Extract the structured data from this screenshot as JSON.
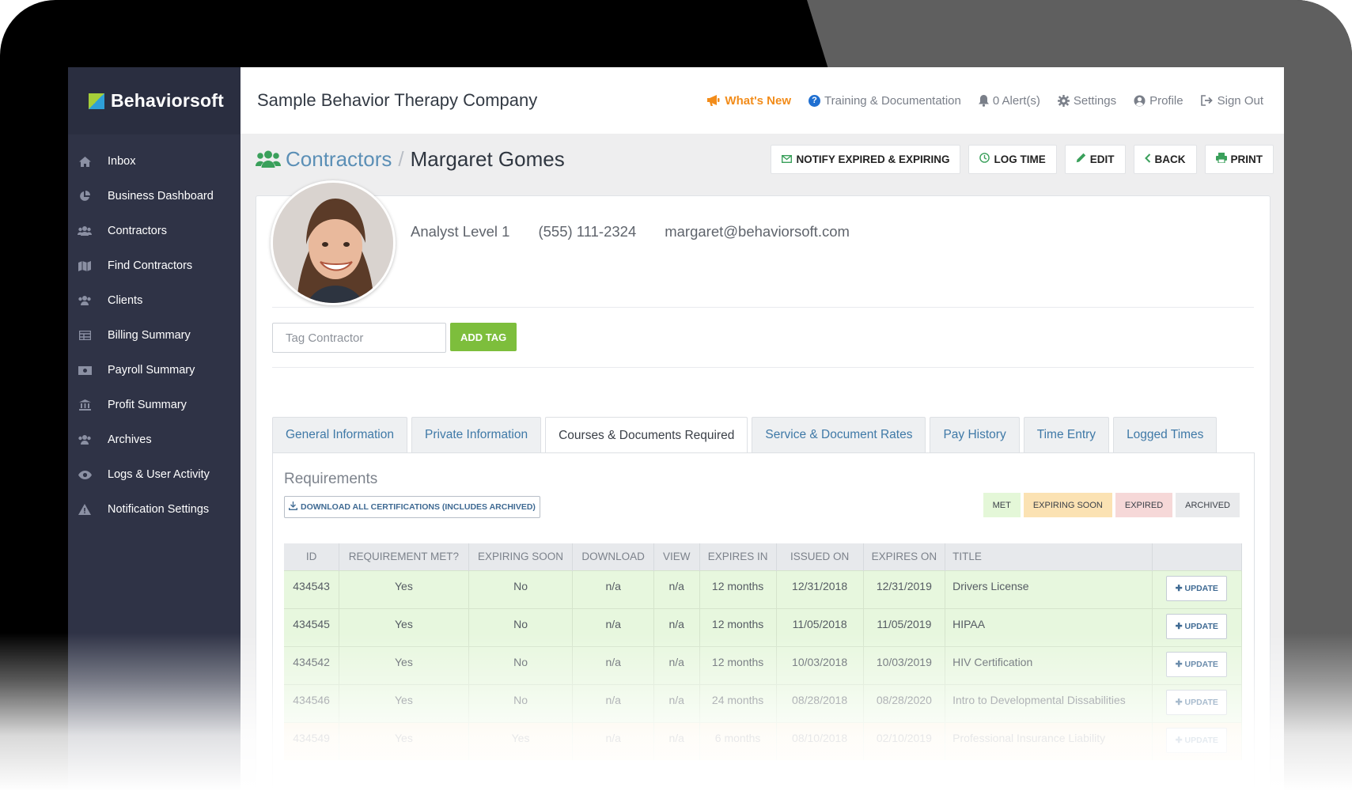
{
  "app": {
    "brand": "Behaviorsoft",
    "company": "Sample Behavior Therapy Company"
  },
  "topnav": [
    {
      "label": "What's New",
      "icon": "megaphone-icon"
    },
    {
      "label": "Training & Documentation",
      "icon": "question-circle-icon"
    },
    {
      "label": "0 Alert(s)",
      "icon": "bell-icon"
    },
    {
      "label": "Settings",
      "icon": "gear-icon"
    },
    {
      "label": "Profile",
      "icon": "user-circle-icon"
    },
    {
      "label": "Sign Out",
      "icon": "sign-out-icon"
    }
  ],
  "sidebar": {
    "items": [
      {
        "label": "Inbox",
        "icon": "home-icon"
      },
      {
        "label": "Business Dashboard",
        "icon": "pie-chart-icon"
      },
      {
        "label": "Contractors",
        "icon": "users-icon"
      },
      {
        "label": "Find Contractors",
        "icon": "map-icon"
      },
      {
        "label": "Clients",
        "icon": "users-icon"
      },
      {
        "label": "Billing Summary",
        "icon": "table-icon"
      },
      {
        "label": "Payroll Summary",
        "icon": "money-icon"
      },
      {
        "label": "Profit Summary",
        "icon": "bank-icon"
      },
      {
        "label": "Archives",
        "icon": "users-icon"
      },
      {
        "label": "Logs & User Activity",
        "icon": "eye-icon"
      },
      {
        "label": "Notification Settings",
        "icon": "warning-icon"
      }
    ]
  },
  "header": {
    "breadcrumb_parent": "Contractors",
    "breadcrumb_sep": "/",
    "breadcrumb_current": "Margaret Gomes",
    "actions": [
      {
        "label": "Notify Expired & Expiring",
        "icon": "envelope-icon"
      },
      {
        "label": "Log Time",
        "icon": "clock-icon"
      },
      {
        "label": "Edit",
        "icon": "pencil-icon"
      },
      {
        "label": "Back",
        "icon": "chevron-left-icon"
      },
      {
        "label": "Print",
        "icon": "printer-icon"
      }
    ]
  },
  "profile": {
    "level": "Analyst Level 1",
    "phone": "(555) 111-2324",
    "email": "margaret@behaviorsoft.com"
  },
  "tag": {
    "placeholder": "Tag Contractor",
    "button": "ADD TAG"
  },
  "tabs": [
    {
      "label": "General Information",
      "active": false
    },
    {
      "label": "Private Information",
      "active": false
    },
    {
      "label": "Courses & Documents Required",
      "active": true
    },
    {
      "label": "Service & Document Rates",
      "active": false
    },
    {
      "label": "Pay History",
      "active": false
    },
    {
      "label": "Time Entry",
      "active": false
    },
    {
      "label": "Logged Times",
      "active": false
    }
  ],
  "requirements": {
    "title": "Requirements",
    "download_label": "Download All Certifications (Includes Archived)",
    "legend": [
      {
        "label": "MET",
        "color": "#e4f7d8"
      },
      {
        "label": "EXPIRING SOON",
        "color": "#fbe2b3"
      },
      {
        "label": "EXPIRED",
        "color": "#f6d8d8"
      },
      {
        "label": "ARCHIVED",
        "color": "#e9eaec"
      }
    ],
    "columns": [
      "ID",
      "REQUIREMENT MET?",
      "EXPIRING SOON",
      "DOWNLOAD",
      "VIEW",
      "EXPIRES IN",
      "ISSUED ON",
      "EXPIRES ON",
      "TITLE",
      ""
    ],
    "update_label": "UPDATE",
    "rows": [
      {
        "id": "434543",
        "met": "Yes",
        "expiring": "No",
        "download": "n/a",
        "view": "n/a",
        "expires_in": "12 months",
        "issued": "12/31/2018",
        "expires": "12/31/2019",
        "title": "Drivers License"
      },
      {
        "id": "434545",
        "met": "Yes",
        "expiring": "No",
        "download": "n/a",
        "view": "n/a",
        "expires_in": "12 months",
        "issued": "11/05/2018",
        "expires": "11/05/2019",
        "title": "HIPAA"
      },
      {
        "id": "434542",
        "met": "Yes",
        "expiring": "No",
        "download": "n/a",
        "view": "n/a",
        "expires_in": "12 months",
        "issued": "10/03/2018",
        "expires": "10/03/2019",
        "title": "HIV Certification"
      },
      {
        "id": "434546",
        "met": "Yes",
        "expiring": "No",
        "download": "n/a",
        "view": "n/a",
        "expires_in": "24 months",
        "issued": "08/28/2018",
        "expires": "08/28/2020",
        "title": "Intro to Developmental Dissabilities"
      },
      {
        "id": "434549",
        "met": "Yes",
        "expiring": "Yes",
        "download": "n/a",
        "view": "n/a",
        "expires_in": "6 months",
        "issued": "08/10/2018",
        "expires": "02/10/2019",
        "title": "Professional Insurance Liability"
      }
    ]
  },
  "colors": {
    "sidebar_bg": "#2f3346",
    "accent_green": "#3aa05b",
    "link_blue": "#3f79a7",
    "whats_new_orange": "#f28c1a",
    "met_row": "#e7f7de",
    "expiring_row": "#fcefd4"
  }
}
